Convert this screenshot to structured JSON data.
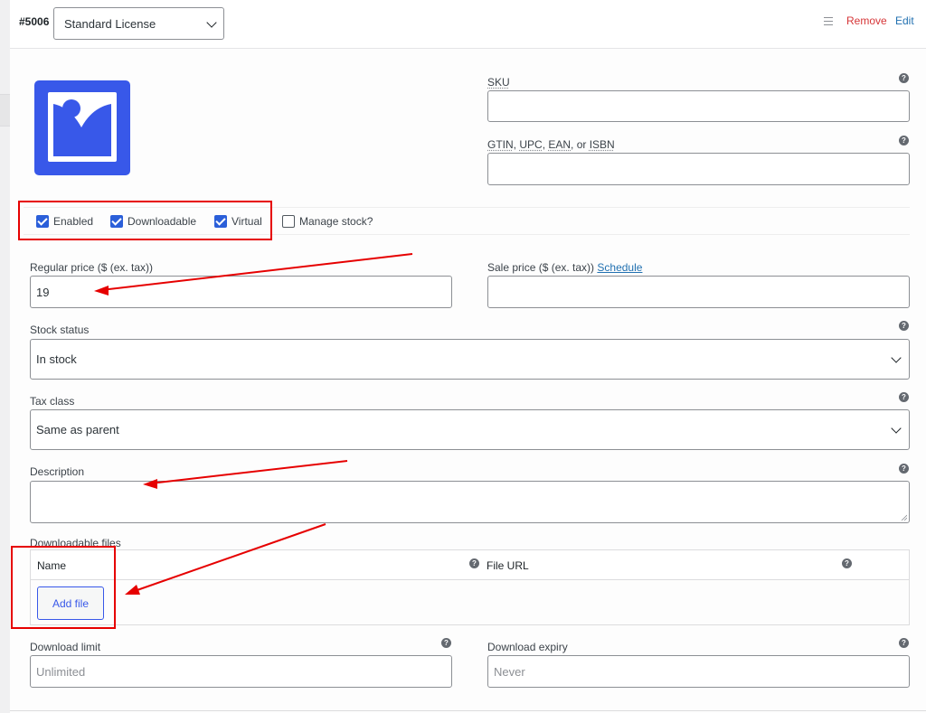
{
  "variation": {
    "id": "#5006",
    "type_select": "Standard License",
    "actions": {
      "remove": "Remove",
      "edit": "Edit"
    }
  },
  "fields": {
    "sku": {
      "label": "SKU",
      "value": ""
    },
    "gtin": {
      "label_abbr": [
        "GTIN",
        "UPC",
        "EAN"
      ],
      "label_sep": ", ",
      "label_tail": ", or ",
      "label_last": "ISBN",
      "value": ""
    },
    "regular_price": {
      "label": "Regular price ($ (ex. tax))",
      "value": "19"
    },
    "sale_price": {
      "label": "Sale price ($ (ex. tax))",
      "schedule_link": "Schedule",
      "value": ""
    },
    "stock_status": {
      "label": "Stock status",
      "value": "In stock"
    },
    "tax_class": {
      "label": "Tax class",
      "value": "Same as parent"
    },
    "description": {
      "label": "Description",
      "value": ""
    },
    "downloadable_files": {
      "label": "Downloadable files",
      "columns": [
        "Name",
        "File URL"
      ],
      "add_button": "Add file"
    },
    "download_limit": {
      "label": "Download limit",
      "placeholder": "Unlimited"
    },
    "download_expiry": {
      "label": "Download expiry",
      "placeholder": "Never"
    }
  },
  "options": [
    {
      "label": "Enabled",
      "checked": true
    },
    {
      "label": "Downloadable",
      "checked": true
    },
    {
      "label": "Virtual",
      "checked": true
    },
    {
      "label": "Manage stock?",
      "checked": false
    }
  ],
  "help_glyph": "?",
  "colors": {
    "accent": "#3858e9",
    "remove": "#d63638",
    "link": "#2271b1",
    "annotation": "#e60000"
  },
  "icons": [
    "chevron-down-icon",
    "drag-handle-icon",
    "help-icon",
    "image-placeholder-icon",
    "resize-grip-icon"
  ]
}
